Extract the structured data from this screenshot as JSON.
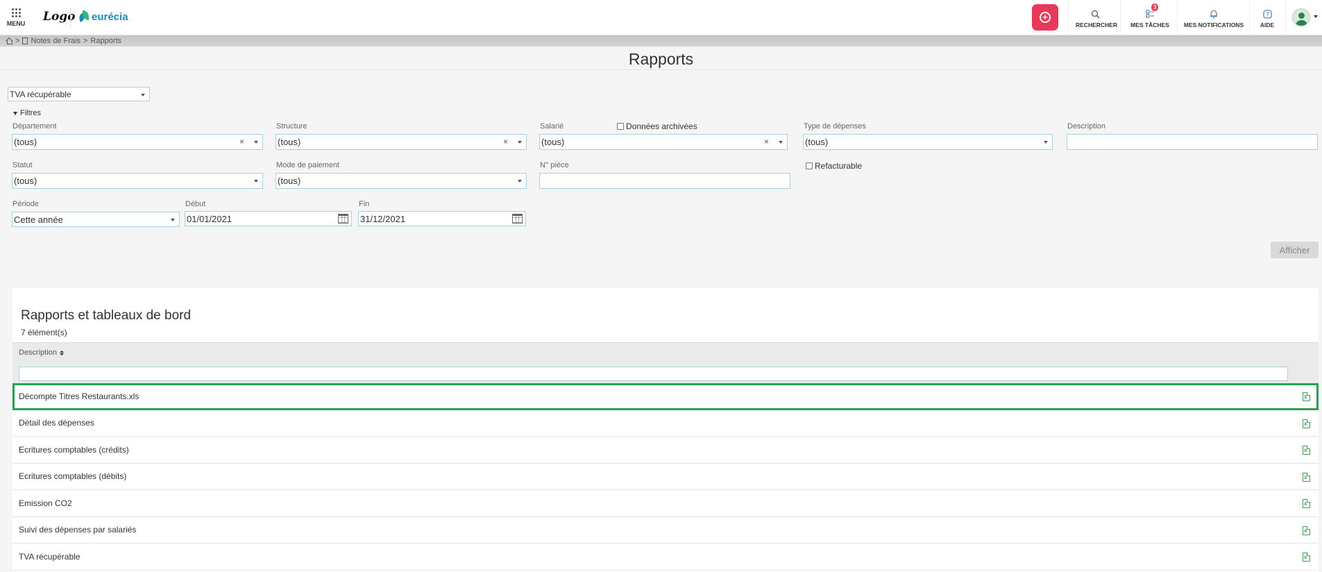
{
  "header": {
    "menu_label": "MENU",
    "logo_text": "Logo",
    "brand_name": "eurécia",
    "items": [
      {
        "label": "RECHERCHER",
        "icon": "search-icon"
      },
      {
        "label": "MES TÂCHES",
        "icon": "tasks-icon",
        "badge": "3"
      },
      {
        "label": "MES NOTIFICATIONS",
        "icon": "bell-icon"
      },
      {
        "label": "AIDE",
        "icon": "help-icon"
      }
    ],
    "accent_color": "#e8395a"
  },
  "breadcrumb": {
    "separator": ">",
    "section": "Notes de Frais",
    "page": "Rapports"
  },
  "page_title": "Rapports",
  "report_selector": {
    "value": "TVA récupérable"
  },
  "filters": {
    "toggle_label": "Filtres",
    "departement": {
      "label": "Département",
      "value": "(tous)"
    },
    "structure": {
      "label": "Structure",
      "value": "(tous)"
    },
    "salarie": {
      "label": "Salarié",
      "value": "(tous)"
    },
    "donnees_archivees": {
      "label": "Données archivées",
      "checked": false
    },
    "type_depenses": {
      "label": "Type de dépenses",
      "value": "(tous)"
    },
    "description": {
      "label": "Description",
      "value": ""
    },
    "statut": {
      "label": "Statut",
      "value": "(tous)"
    },
    "mode_paiement": {
      "label": "Mode de paiement",
      "value": "(tous)"
    },
    "num_piece": {
      "label": "N° pièce",
      "value": ""
    },
    "refacturable": {
      "label": "Refacturable",
      "checked": false
    },
    "periode": {
      "label": "Période",
      "value": "Cette année"
    },
    "debut": {
      "label": "Début",
      "value": "01/01/2021"
    },
    "fin": {
      "label": "Fin",
      "value": "31/12/2021"
    },
    "submit_label": "Afficher"
  },
  "reports": {
    "title": "Rapports et tableaux de bord",
    "count": "7 élément(s)",
    "column_header": "Description",
    "filter_value": "",
    "items": [
      {
        "label": "Décompte Titres Restaurants.xls",
        "icon": "excel-file-icon",
        "selected": true
      },
      {
        "label": "Détail des dépenses",
        "icon": "excel-file-icon"
      },
      {
        "label": "Ecritures comptables (crédits)",
        "icon": "excel-file-icon"
      },
      {
        "label": "Ecritures comptables (débits)",
        "icon": "excel-file-icon"
      },
      {
        "label": "Emission CO2",
        "icon": "excel-file-icon"
      },
      {
        "label": "Suivi des dépenses par salariés",
        "icon": "excel-file-icon"
      },
      {
        "label": "TVA récupérable",
        "icon": "excel-file-icon"
      }
    ],
    "selection_color": "#2aa152"
  }
}
